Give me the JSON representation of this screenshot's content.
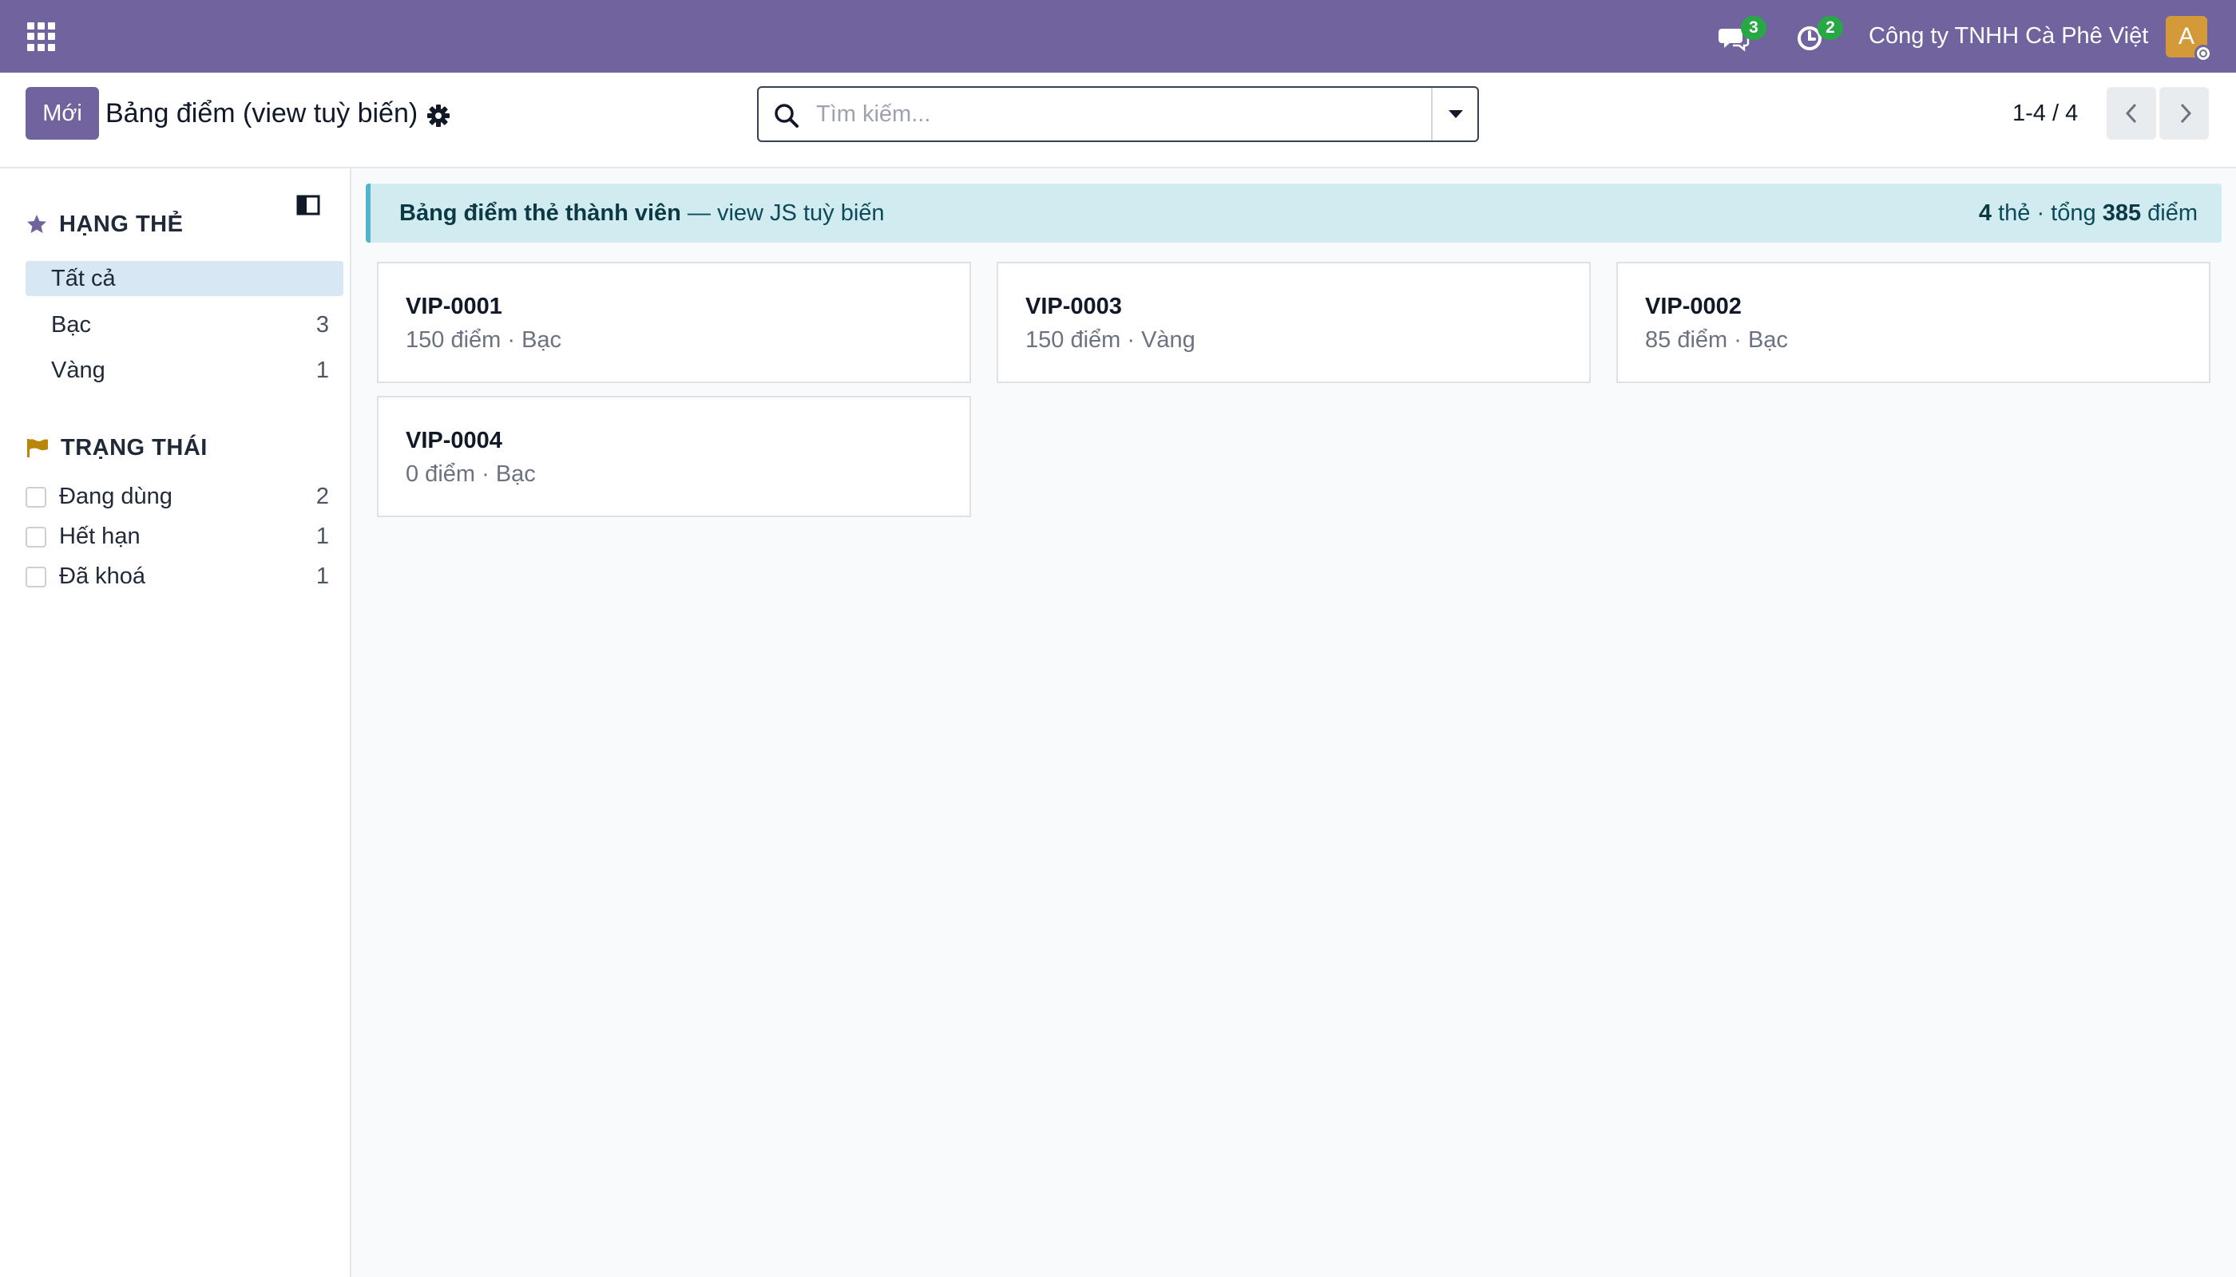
{
  "navbar": {
    "messages_badge": "3",
    "activities_badge": "2",
    "company": "Công ty TNHH Cà Phê Việt",
    "avatar_letter": "A",
    "color": "#71639e"
  },
  "control": {
    "new_label": "Mới",
    "title": "Bảng điểm (view tuỳ biến)",
    "search_placeholder": "Tìm kiếm...",
    "pager": "1-4 / 4"
  },
  "sidebar": {
    "tier_header": "HẠNG THẺ",
    "tiers": [
      {
        "label": "Tất cả",
        "count": ""
      },
      {
        "label": "Bạc",
        "count": "3"
      },
      {
        "label": "Vàng",
        "count": "1"
      }
    ],
    "status_header": "TRẠNG THÁI",
    "statuses": [
      {
        "label": "Đang dùng",
        "count": "2"
      },
      {
        "label": "Hết hạn",
        "count": "1"
      },
      {
        "label": "Đã khoá",
        "count": "1"
      }
    ]
  },
  "banner": {
    "title": "Bảng điểm thẻ thành viên",
    "subtitle": " — view JS tuỳ biến",
    "card_count": "4",
    "card_unit": " thẻ · tổng ",
    "total_points": "385",
    "points_unit": " điểm"
  },
  "cards": [
    {
      "code": "VIP-0001",
      "detail": "150 điểm · Bạc"
    },
    {
      "code": "VIP-0003",
      "detail": "150 điểm · Vàng"
    },
    {
      "code": "VIP-0002",
      "detail": "85 điểm · Bạc"
    },
    {
      "code": "VIP-0004",
      "detail": "0 điểm · Bạc"
    }
  ]
}
